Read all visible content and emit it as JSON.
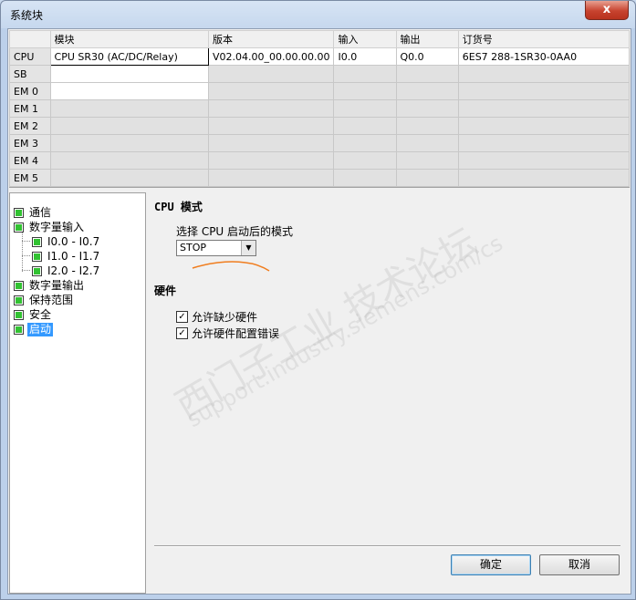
{
  "window": {
    "title": "系统块",
    "close_glyph": "x"
  },
  "grid": {
    "headers": [
      "",
      "模块",
      "版本",
      "输入",
      "输出",
      "订货号"
    ],
    "rows": [
      {
        "slot": "CPU",
        "module": "CPU SR30 (AC/DC/Relay)",
        "version": "V02.04.00_00.00.00.00",
        "input": "I0.0",
        "output": "Q0.0",
        "order": "6ES7 288-1SR30-0AA0"
      },
      {
        "slot": "SB",
        "module": "",
        "version": "",
        "input": "",
        "output": "",
        "order": ""
      },
      {
        "slot": "EM 0",
        "module": "",
        "version": "",
        "input": "",
        "output": "",
        "order": ""
      },
      {
        "slot": "EM 1",
        "module": "",
        "version": "",
        "input": "",
        "output": "",
        "order": ""
      },
      {
        "slot": "EM 2",
        "module": "",
        "version": "",
        "input": "",
        "output": "",
        "order": ""
      },
      {
        "slot": "EM 3",
        "module": "",
        "version": "",
        "input": "",
        "output": "",
        "order": ""
      },
      {
        "slot": "EM 4",
        "module": "",
        "version": "",
        "input": "",
        "output": "",
        "order": ""
      },
      {
        "slot": "EM 5",
        "module": "",
        "version": "",
        "input": "",
        "output": "",
        "order": ""
      }
    ]
  },
  "tree": {
    "items": [
      {
        "label": "通信"
      },
      {
        "label": "数字量输入"
      },
      {
        "label": "I0.0 - I0.7"
      },
      {
        "label": "I1.0 - I1.7"
      },
      {
        "label": "I2.0 - I2.7"
      },
      {
        "label": "数字量输出"
      },
      {
        "label": "保持范围"
      },
      {
        "label": "安全"
      },
      {
        "label": "启动"
      }
    ],
    "selected": "启动"
  },
  "panel": {
    "cpu_mode_heading": "CPU 模式",
    "startup_label": "选择 CPU 启动后的模式",
    "startup_value": "STOP",
    "dropdown_glyph": "▼",
    "hardware_heading": "硬件",
    "allow_missing_hw": "允许缺少硬件",
    "allow_hw_config_errors": "允许硬件配置错误",
    "check_glyph": "✓"
  },
  "buttons": {
    "ok": "确定",
    "cancel": "取消"
  },
  "watermark": {
    "line1": "西门子工业 技术论坛",
    "line2": "support.industry.siemens.com/cs"
  },
  "colors": {
    "tree_status_green": "#32c232",
    "selection_blue": "#3399ff",
    "close_red": "#c7432f",
    "annotation_orange": "#f07d1e"
  }
}
